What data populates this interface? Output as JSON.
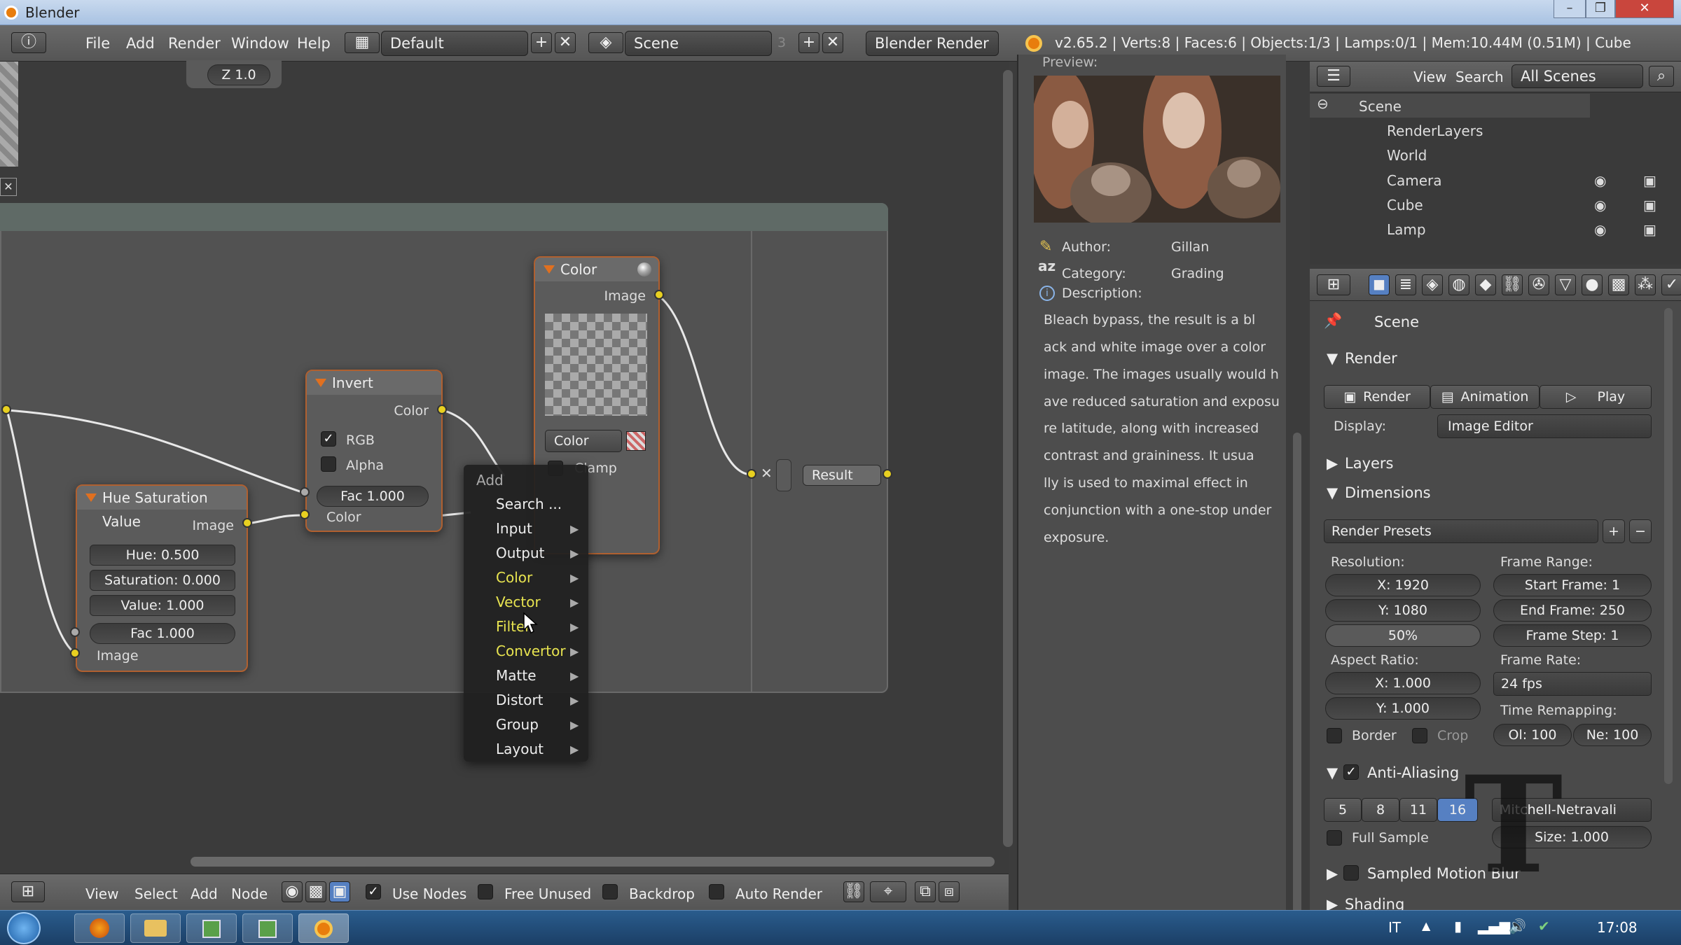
{
  "window": {
    "title": "Blender",
    "min": "–",
    "max": "❐",
    "close": "✕"
  },
  "header": {
    "menus": [
      "File",
      "Add",
      "Render",
      "Window",
      "Help"
    ],
    "layout": "Default",
    "scene": "Scene",
    "scene_users": "3",
    "engine": "Blender Render",
    "stats": "v2.65.2 | Verts:8 | Faces:6 | Objects:1/3 | Lamps:0/1 | Mem:10.44M (0.51M) | Cube"
  },
  "editor": {
    "z_field": "Z 1.0",
    "nodes": {
      "invert": {
        "title": "Invert",
        "out_color": "Color",
        "rgb": "RGB",
        "alpha": "Alpha",
        "fac": "Fac 1.000",
        "in_color": "Color"
      },
      "hsv": {
        "title": "Hue Saturation Value",
        "out_image": "Image",
        "hue": "Hue: 0.500",
        "saturation": "Saturation: 0.000",
        "value": "Value: 1.000",
        "fac": "Fac 1.000",
        "in_image": "Image"
      },
      "color": {
        "title": "Color",
        "out_image": "Image",
        "mode": "Color",
        "clamp": "Clamp"
      },
      "result": {
        "label": "Result"
      }
    },
    "add_menu": {
      "title": "Add",
      "items": [
        "Search ...",
        "Input",
        "Output",
        "Color",
        "Vector",
        "Filter",
        "Convertor",
        "Matte",
        "Distort",
        "Group",
        "Layout"
      ]
    }
  },
  "footer": {
    "menus": [
      "View",
      "Select",
      "Add",
      "Node"
    ],
    "use_nodes": "Use Nodes",
    "free_unused": "Free Unused",
    "backdrop": "Backdrop",
    "auto_render": "Auto Render"
  },
  "preview": {
    "label": "Preview:",
    "author_label": "Author:",
    "author": "Gillan",
    "category_label": "Category:",
    "category": "Grading",
    "description_label": "Description:",
    "description_lines": [
      "Bleach bypass, the result is a bl",
      "ack and white image over a color",
      "image. The images usually would h",
      "ave reduced saturation and exposu",
      "re latitude, along with increased",
      " contrast and graininess. It usua",
      "lly is used to maximal effect in",
      "conjunction with a one-stop under",
      "exposure."
    ]
  },
  "outliner": {
    "view": "View",
    "search": "Search",
    "filter": "All Scenes",
    "items": [
      "Scene",
      "RenderLayers",
      "World",
      "Camera",
      "Cube",
      "Lamp"
    ]
  },
  "properties": {
    "context": "Scene",
    "render_section": "Render",
    "render_btn": "Render",
    "animation_btn": "Animation",
    "play_btn": "Play",
    "display_label": "Display:",
    "display_value": "Image Editor",
    "layers": "Layers",
    "dimensions": "Dimensions",
    "presets": "Render Presets",
    "resolution": "Resolution:",
    "res_x": "X: 1920",
    "res_y": "Y: 1080",
    "res_pct": "50%",
    "frame_range": "Frame Range:",
    "start": "Start Frame: 1",
    "end": "End Frame: 250",
    "step": "Frame Step: 1",
    "aspect": "Aspect Ratio:",
    "asp_x": "X: 1.000",
    "asp_y": "Y: 1.000",
    "frame_rate": "Frame Rate:",
    "fps": "24 fps",
    "time_remap": "Time Remapping:",
    "old": "Ol: 100",
    "new": "Ne: 100",
    "border": "Border",
    "crop": "Crop",
    "aa": "Anti-Aliasing",
    "aa_samples": [
      "5",
      "8",
      "11",
      "16"
    ],
    "filter": "Mitchell-Netravali",
    "full_sample": "Full Sample",
    "size": "Size: 1.000",
    "motion_blur": "Sampled Motion Blur",
    "shading": "Shading"
  },
  "taskbar": {
    "lang": "IT",
    "time": "17:08"
  }
}
